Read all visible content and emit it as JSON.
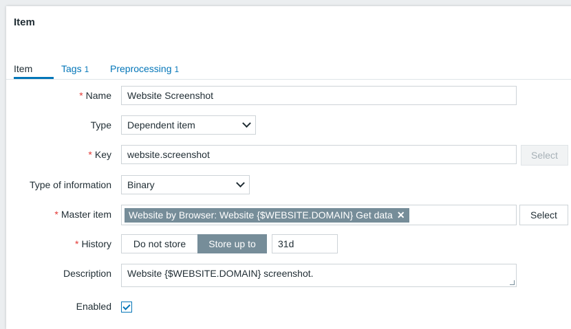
{
  "window": {
    "title": "Item"
  },
  "tabs": [
    {
      "label": "Item",
      "count": ""
    },
    {
      "label": "Tags",
      "count": "1"
    },
    {
      "label": "Preprocessing",
      "count": "1"
    }
  ],
  "form": {
    "name": {
      "label": "Name",
      "value": "Website Screenshot",
      "required": true
    },
    "type": {
      "label": "Type",
      "value": "Dependent item"
    },
    "key": {
      "label": "Key",
      "value": "website.screenshot",
      "required": true,
      "select_label": "Select"
    },
    "type_of_information": {
      "label": "Type of information",
      "value": "Binary"
    },
    "master_item": {
      "label": "Master item",
      "chip": "Website by Browser: Website {$WEBSITE.DOMAIN} Get data",
      "chip_remove": "✕",
      "select_label": "Select",
      "required": true
    },
    "history": {
      "label": "History",
      "options": [
        "Do not store",
        "Store up to"
      ],
      "selected": "Store up to",
      "value": "31d",
      "required": true
    },
    "description": {
      "label": "Description",
      "value": "Website {$WEBSITE.DOMAIN} screenshot."
    },
    "enabled": {
      "label": "Enabled",
      "checked": true
    }
  },
  "required_mark": "*",
  "colors": {
    "accent": "#0275b8",
    "required": "#e33734",
    "chip": "#768d99"
  }
}
